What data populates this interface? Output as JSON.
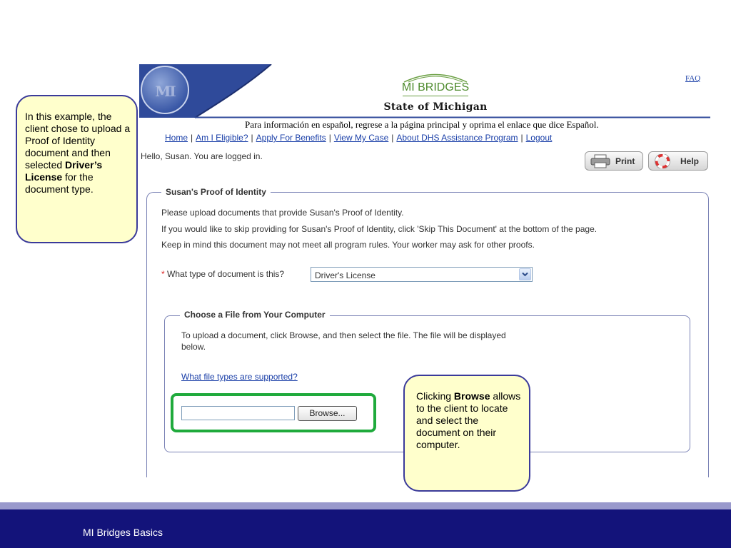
{
  "header": {
    "seal_letters": "MI",
    "brand_name": "MI BRIDGES",
    "brand_subtitle": "State of Michigan",
    "faq_label": "FAQ",
    "spanish_note": "Para información en español, regrese a la página principal y oprima el enlace que dice Español."
  },
  "nav": {
    "items": [
      {
        "label": "Home"
      },
      {
        "label": "Am I Eligible?"
      },
      {
        "label": "Apply For Benefits"
      },
      {
        "label": "View My Case"
      },
      {
        "label": "About DHS Assistance Program"
      },
      {
        "label": "Logout"
      }
    ],
    "separator": "|"
  },
  "greeting": "Hello, Susan. You are logged in.",
  "toolbar": {
    "print_label": "Print",
    "help_label": "Help"
  },
  "proof_section": {
    "legend": "Susan's Proof of Identity",
    "line1": "Please upload documents that provide Susan's Proof of Identity.",
    "line2": "If you would like to skip providing for Susan's Proof of Identity, click 'Skip This Document' at the bottom of the page.",
    "line3": "Keep in mind this document may not meet all program rules. Your worker may ask for other proofs.",
    "required_mark": "*",
    "doc_type_label": "What type of document is this?",
    "doc_type_value": "Driver's License"
  },
  "file_section": {
    "legend": "Choose a File from Your Computer",
    "instructions": "To upload a document, click Browse, and then select the file. The file will be displayed below.",
    "filetypes_link": "What file types are supported?",
    "file_value": "",
    "browse_label": "Browse..."
  },
  "callouts": {
    "left_pre": "In this example, the client chose to upload a Proof of Identity document and then selected ",
    "left_bold": "Driver’s License",
    "left_post": " for the document type.",
    "right_pre": "Clicking ",
    "right_bold": "Browse",
    "right_post": " allows to the client to locate and select the document on their computer."
  },
  "footer": {
    "title": "MI Bridges Basics"
  },
  "colors": {
    "brand_green": "#4d8a2c",
    "link_blue": "#1a3fa8",
    "highlight_green": "#1faa3c",
    "footer_navy": "#13137a",
    "callout_fill": "#ffffcc"
  }
}
